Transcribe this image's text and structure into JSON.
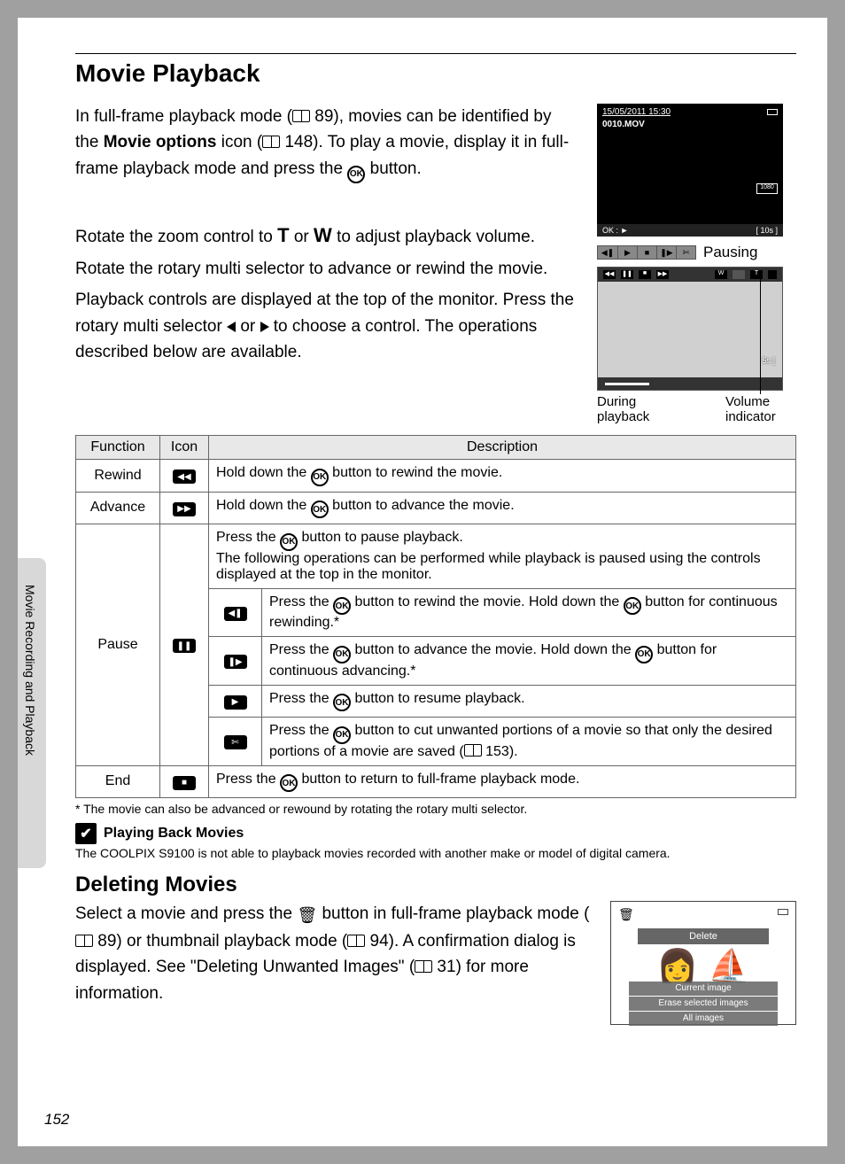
{
  "sideTab": "Movie Recording and Playback",
  "title": "Movie Playback",
  "intro": {
    "p1a": "In full-frame playback mode (",
    "p1_ref1": " 89), movies can be identified by the ",
    "p1_bold": "Movie options",
    "p1b": " icon (",
    "p1_ref2": " 148). To play a movie, display it in full-frame playback mode and press the ",
    "p1c": " button.",
    "p2a": "Rotate the zoom control to ",
    "p2_T": "T",
    "p2_mid": " or ",
    "p2_W": "W",
    "p2b": " to adjust playback volume.",
    "p3": "Rotate the rotary multi selector to advance or rewind the movie.",
    "p4a": "Playback controls are displayed at the top of the monitor. Press the rotary multi selector ",
    "p4_mid": " or ",
    "p4b": " to choose a control. The operations described below are available."
  },
  "lcd1": {
    "date": "15/05/2011 15:30",
    "file": "0010.MOV",
    "ok": "OK : ►",
    "dur": "[      10s ]"
  },
  "pausingLabel": "Pausing",
  "lcd2_time": "5s ]",
  "labels": {
    "during": "During playback",
    "volume": "Volume indicator"
  },
  "table": {
    "hFunc": "Function",
    "hIcon": "Icon",
    "hDesc": "Description",
    "rewind": {
      "f": "Rewind",
      "d1": "Hold down the ",
      "d2": " button to rewind the movie."
    },
    "advance": {
      "f": "Advance",
      "d1": "Hold down the ",
      "d2": " button to advance the movie."
    },
    "pause": {
      "f": "Pause",
      "intro1": "Press the ",
      "intro2": " button to pause playback.",
      "intro3": "The following operations can be performed while playback is paused using the controls displayed at the top in the monitor.",
      "r1a": "Press the ",
      "r1b": " button to rewind the movie. Hold down the ",
      "r1c": " button for continuous rewinding.*",
      "r2a": "Press the ",
      "r2b": " button to advance the movie. Hold down the ",
      "r2c": " button for continuous advancing.*",
      "r3a": "Press the ",
      "r3b": " button to resume playback.",
      "r4a": "Press the ",
      "r4b": " button to cut unwanted portions of a movie so that only the desired portions of a movie are saved (",
      "r4c": " 153)."
    },
    "end": {
      "f": "End",
      "d1": "Press the ",
      "d2": " button to return to full-frame playback mode."
    }
  },
  "footnote": "*   The movie can also be advanced or rewound by rotating the rotary multi selector.",
  "noteTitle": "Playing Back Movies",
  "noteText": "The COOLPIX S9100 is not able to playback movies recorded with another make or model of digital camera.",
  "delTitle": "Deleting Movies",
  "del": {
    "a": "Select a movie and press the ",
    "b": " button in full-frame playback mode (",
    "c": " 89) or thumbnail playback mode (",
    "d": " 94). A confirmation dialog is displayed. See \"Deleting Unwanted Images\" (",
    "e": " 31) for more information."
  },
  "delMenu": {
    "hdr": "Delete",
    "o1": "Current image",
    "o2": "Erase selected images",
    "o3": "All images"
  },
  "pageNum": "152",
  "okText": "OK",
  "icons": {
    "rw": "◀◀",
    "ff": "▶▶",
    "pause": "❚❚",
    "frw": "◀❚",
    "ffw": "❚▶",
    "play": "▶",
    "cut": "✄",
    "stop": "■"
  }
}
